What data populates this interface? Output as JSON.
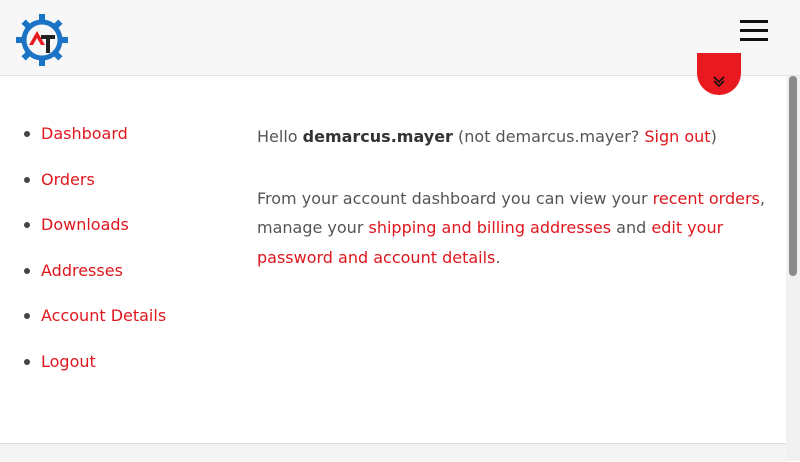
{
  "header": {
    "logo_letters": "AT",
    "menu_icon": "hamburger-icon"
  },
  "scroll_button": {
    "icon": "double-chevron-down-icon"
  },
  "nav": {
    "items": [
      {
        "label": "Dashboard"
      },
      {
        "label": "Orders"
      },
      {
        "label": "Downloads"
      },
      {
        "label": "Addresses"
      },
      {
        "label": "Account Details"
      },
      {
        "label": "Logout"
      }
    ]
  },
  "main": {
    "greeting": {
      "hello": "Hello ",
      "username": "demarcus.mayer",
      "not_prefix": " (not demarcus.mayer? ",
      "signout_link": "Sign out",
      "close_paren": ")"
    },
    "intro": {
      "part1": "From your account dashboard you can view your ",
      "link_orders": "recent orders",
      "part2": ", manage your ",
      "link_addresses": "shipping and billing addresses",
      "part3": " and ",
      "link_account": "edit your password and account details",
      "part4": "."
    }
  },
  "colors": {
    "accent": "#e0161d",
    "logo_blue": "#1a73c4",
    "logo_red": "#e8191f",
    "text": "#555555"
  }
}
